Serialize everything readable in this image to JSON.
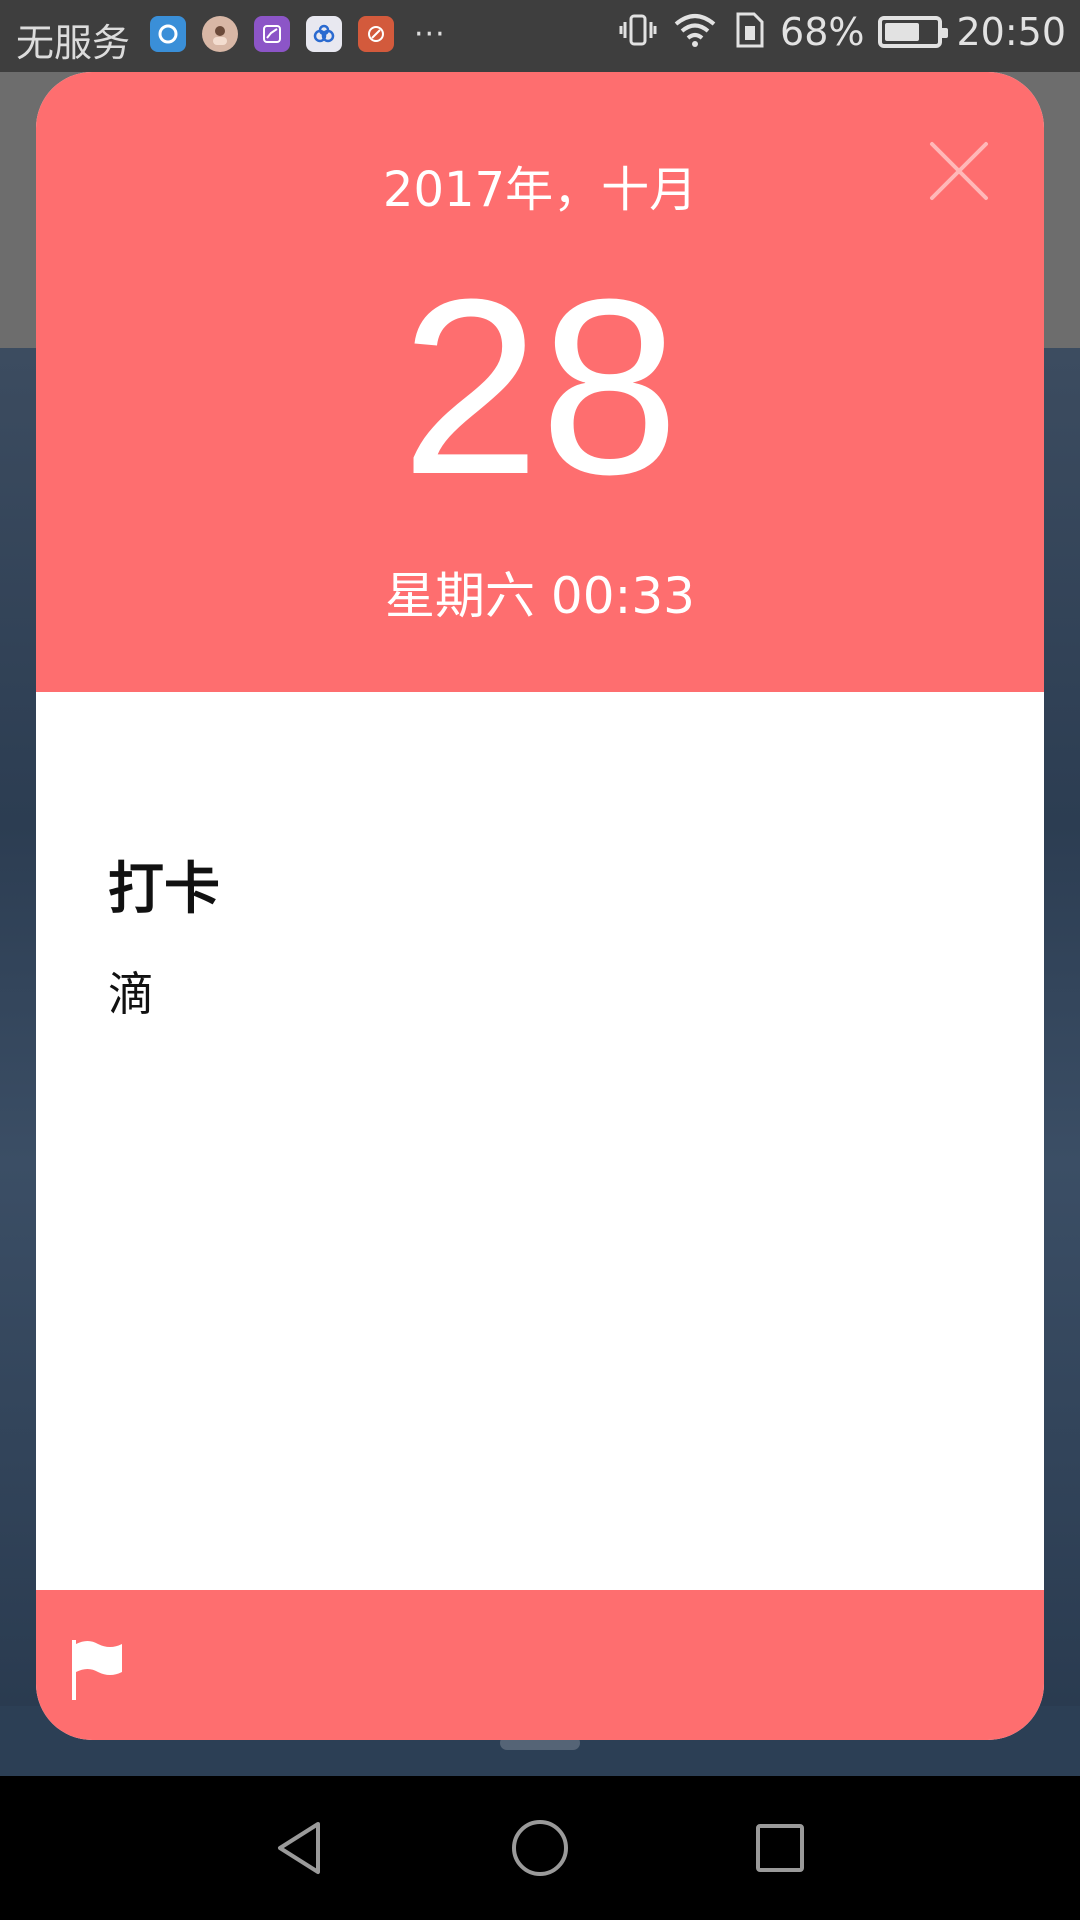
{
  "status_bar": {
    "carrier": "无服务",
    "more_indicator": "···",
    "battery_percent": "68%",
    "time": "20:50",
    "battery_level": 0.68
  },
  "card": {
    "year_month": "2017年，十月",
    "day": "28",
    "weekday_time": "星期六 00:33",
    "event_title": "打卡",
    "event_note": "滴",
    "accent_color": "#fe6e6f"
  },
  "icons": {
    "close": "close-icon",
    "flag": "flag-icon",
    "nav_back": "back-icon",
    "nav_home": "home-icon",
    "nav_recent": "recent-apps-icon"
  }
}
